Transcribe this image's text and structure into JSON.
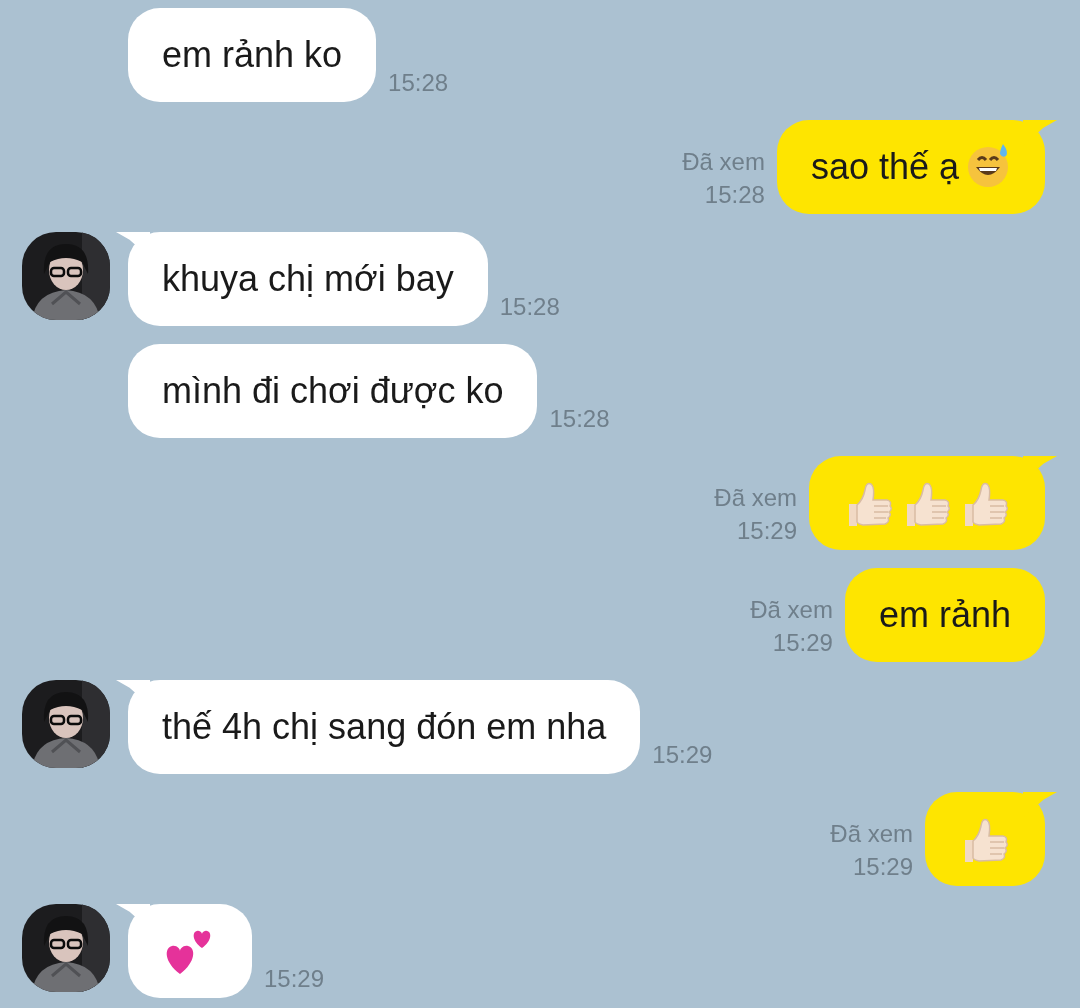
{
  "messages": [
    {
      "kind": "incoming",
      "avatar": false,
      "tail": false,
      "text": "em rảnh ko",
      "time": "15:28"
    },
    {
      "kind": "outgoing",
      "tail": true,
      "text": "sao thế ạ",
      "emojis": [
        {
          "kind": "grin-sweat"
        }
      ],
      "read": "Đã xem",
      "time": "15:28"
    },
    {
      "kind": "incoming",
      "avatar": true,
      "tail": true,
      "text": "khuya chị mới bay",
      "time": "15:28"
    },
    {
      "kind": "incoming",
      "avatar": false,
      "tail": false,
      "text": "mình đi chơi được ko",
      "time": "15:28"
    },
    {
      "kind": "outgoing",
      "tail": true,
      "emojis": [
        {
          "kind": "thumbs-up"
        },
        {
          "kind": "thumbs-up"
        },
        {
          "kind": "thumbs-up"
        }
      ],
      "read": "Đã xem",
      "time": "15:29"
    },
    {
      "kind": "outgoing",
      "tail": false,
      "text": "em rảnh",
      "read": "Đã xem",
      "time": "15:29"
    },
    {
      "kind": "incoming",
      "avatar": true,
      "tail": true,
      "text": "thế 4h chị sang đón em nha",
      "time": "15:29"
    },
    {
      "kind": "outgoing",
      "tail": true,
      "emojis": [
        {
          "kind": "thumbs-up"
        }
      ],
      "read": "Đã xem",
      "time": "15:29"
    },
    {
      "kind": "incoming",
      "avatar": true,
      "tail": true,
      "emojis": [
        {
          "kind": "two-hearts"
        }
      ],
      "time": "15:29"
    }
  ]
}
